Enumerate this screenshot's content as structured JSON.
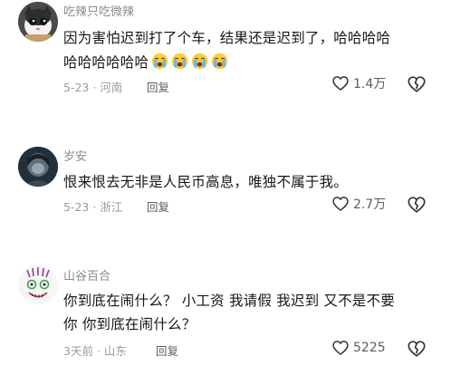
{
  "comments": [
    {
      "username": "吃辣只吃微辣",
      "lines": [
        "因为害怕迟到打了个车，结果还是迟到了，哈哈哈哈",
        "哈哈哈哈哈哈"
      ],
      "emoji_count": 4,
      "emoji_icon": "loudly-crying-face-icon",
      "date": "5-23",
      "location": "河南",
      "meta": "5-23 · 河南",
      "reply_label": "回复",
      "likes": "1.4万"
    },
    {
      "username": "岁安",
      "lines": [
        "恨来恨去无非是人民币高息，唯独不属于我。"
      ],
      "date": "5-23",
      "location": "浙江",
      "meta": "5-23 · 浙江",
      "reply_label": "回复",
      "likes": "2.7万"
    },
    {
      "username": "山谷百合",
      "lines": [
        "你到底在闹什么？ 小工资 我请假 我迟到 又不是不要",
        "你 你到底在闹什么？"
      ],
      "date": "3天前",
      "location": "山东",
      "meta": "3天前 · 山东",
      "reply_label": "回复",
      "likes": "5225"
    }
  ],
  "colors": {
    "text_primary": "#161616",
    "text_secondary": "#8c8c8c",
    "icon": "#333333"
  }
}
